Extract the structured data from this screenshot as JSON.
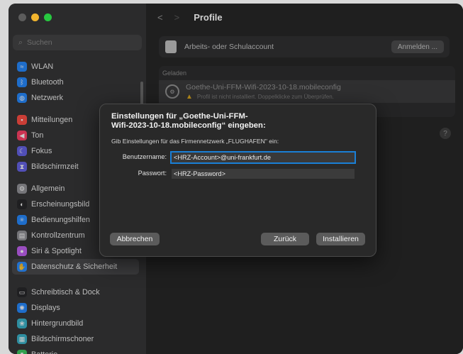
{
  "sidebar": {
    "search_placeholder": "Suchen",
    "items": [
      {
        "label": "WLAN",
        "icon": "wifi-icon",
        "color": "#1a84ff"
      },
      {
        "label": "Bluetooth",
        "icon": "bluetooth-icon",
        "color": "#1a84ff"
      },
      {
        "label": "Netzwerk",
        "icon": "globe-icon",
        "color": "#1a84ff"
      },
      {
        "label": "Mitteilungen",
        "icon": "bell-icon",
        "color": "#ff453a"
      },
      {
        "label": "Ton",
        "icon": "speaker-icon",
        "color": "#ff375f"
      },
      {
        "label": "Fokus",
        "icon": "moon-icon",
        "color": "#5e5ce6"
      },
      {
        "label": "Bildschirmzeit",
        "icon": "hourglass-icon",
        "color": "#5e5ce6"
      },
      {
        "label": "Allgemein",
        "icon": "gear-icon",
        "color": "#8e8e93"
      },
      {
        "label": "Erscheinungsbild",
        "icon": "appearance-icon",
        "color": "#1c1c1e"
      },
      {
        "label": "Bedienungshilfen",
        "icon": "accessibility-icon",
        "color": "#1a84ff"
      },
      {
        "label": "Kontrollzentrum",
        "icon": "control-center-icon",
        "color": "#8e8e93"
      },
      {
        "label": "Siri & Spotlight",
        "icon": "siri-icon",
        "color": "#bf5af2"
      },
      {
        "label": "Datenschutz & Sicherheit",
        "icon": "hand-icon",
        "color": "#1a84ff"
      },
      {
        "label": "Schreibtisch & Dock",
        "icon": "dock-icon",
        "color": "#1c1c1e"
      },
      {
        "label": "Displays",
        "icon": "display-icon",
        "color": "#1a84ff"
      },
      {
        "label": "Hintergrundbild",
        "icon": "wallpaper-icon",
        "color": "#30b0c7"
      },
      {
        "label": "Bildschirmschoner",
        "icon": "screensaver-icon",
        "color": "#30b0c7"
      },
      {
        "label": "Batterie",
        "icon": "battery-icon",
        "color": "#34c759"
      }
    ]
  },
  "header": {
    "title": "Profile",
    "back": "<",
    "forward": ">"
  },
  "work_account": {
    "label": "Arbeits- oder Schulaccount",
    "button": "Anmelden ..."
  },
  "loaded": {
    "heading": "Geladen",
    "profile_name": "Goethe-Uni-FFM-Wifi-2023-10-18.mobileconfig",
    "warning": "Profil ist nicht installiert. Doppelklicke zum Überprüfen."
  },
  "help": "?",
  "dialog": {
    "title_line1": "Einstellungen für „Goethe-Uni-FFM-",
    "title_line2": "Wifi-2023-10-18.mobileconfig“ eingeben:",
    "subtitle": "Gib Einstellungen für das Firmennetzwerk „FLUGHAFEN\" ein:",
    "username_label": "Benutzername:",
    "username_value": "<HRZ-Account>@uni-frankfurt.de",
    "password_label": "Passwort:",
    "password_value": "<HRZ-Password>",
    "cancel": "Abbrechen",
    "back": "Zurück",
    "install": "Installieren"
  },
  "colors": {
    "focus": "#1a7fd6",
    "warning": "#b88d1a"
  }
}
